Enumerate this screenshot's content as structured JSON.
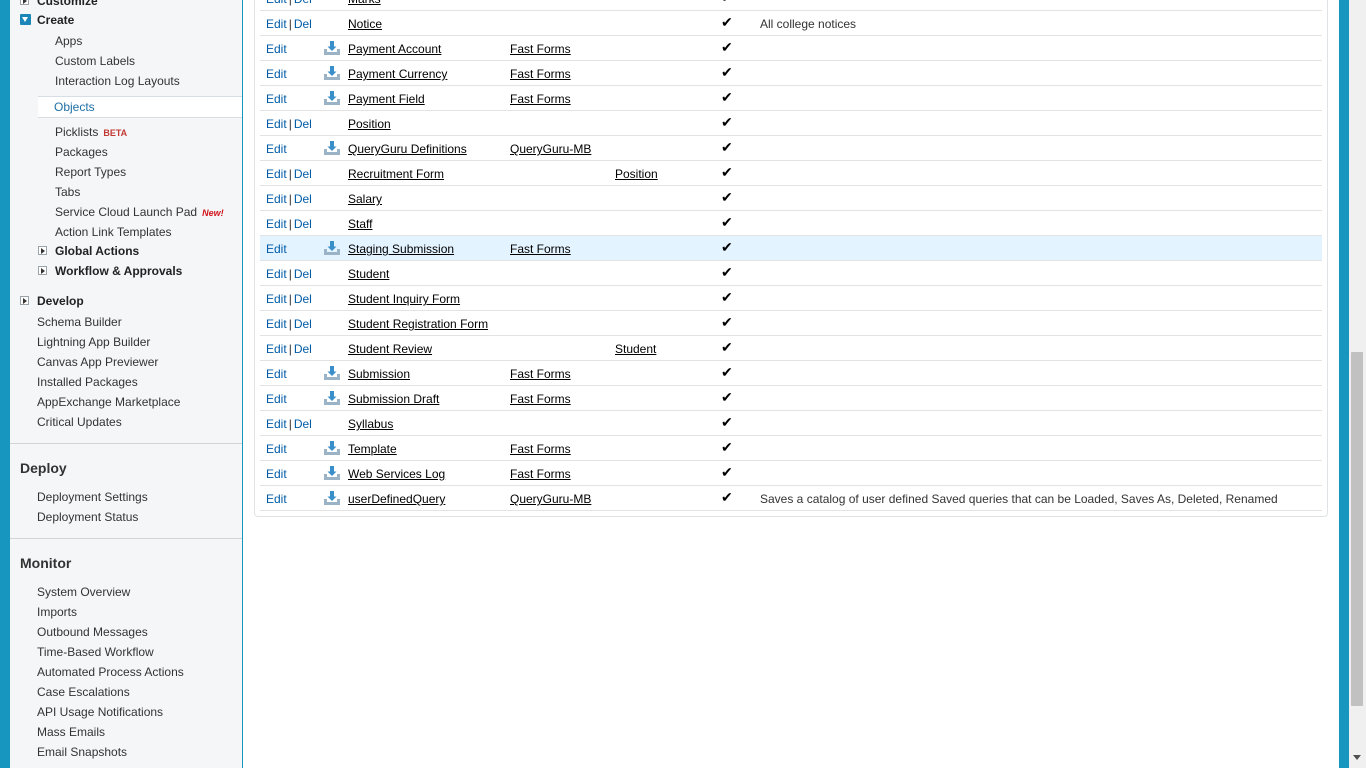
{
  "sidebar": {
    "customize_label": "Customize",
    "create_label": "Create",
    "create_items": [
      {
        "label": "Apps"
      },
      {
        "label": "Custom Labels"
      },
      {
        "label": "Interaction Log Layouts"
      },
      {
        "label": "Objects",
        "selected": true
      },
      {
        "label": "Picklists",
        "badge": "BETA"
      },
      {
        "label": "Packages"
      },
      {
        "label": "Report Types"
      },
      {
        "label": "Tabs"
      },
      {
        "label": "Service Cloud Launch Pad",
        "badge": "New!"
      },
      {
        "label": "Action Link Templates"
      }
    ],
    "global_actions_label": "Global Actions",
    "workflow_label": "Workflow & Approvals",
    "develop_label": "Develop",
    "develop_items": [
      {
        "label": "Schema Builder"
      },
      {
        "label": "Lightning App Builder"
      },
      {
        "label": "Canvas App Previewer"
      },
      {
        "label": "Installed Packages"
      },
      {
        "label": "AppExchange Marketplace"
      },
      {
        "label": "Critical Updates"
      }
    ],
    "deploy_title": "Deploy",
    "deploy_items": [
      {
        "label": "Deployment Settings"
      },
      {
        "label": "Deployment Status"
      }
    ],
    "monitor_title": "Monitor",
    "monitor_items": [
      {
        "label": "System Overview"
      },
      {
        "label": "Imports"
      },
      {
        "label": "Outbound Messages"
      },
      {
        "label": "Time-Based Workflow"
      },
      {
        "label": "Automated Process Actions"
      },
      {
        "label": "Case Escalations"
      },
      {
        "label": "API Usage Notifications"
      },
      {
        "label": "Mass Emails"
      },
      {
        "label": "Email Snapshots"
      }
    ]
  },
  "objects_table": {
    "edit_label": "Edit",
    "del_label": "Del",
    "separator": "|",
    "deployed_mark": "✔",
    "rows": [
      {
        "label": "Marks",
        "has_del": true,
        "managed": false,
        "package": "",
        "master": "",
        "description": ""
      },
      {
        "label": "Notice",
        "has_del": true,
        "managed": false,
        "package": "",
        "master": "",
        "description": "All college notices"
      },
      {
        "label": "Payment Account",
        "has_del": false,
        "managed": true,
        "package": "Fast Forms",
        "master": "",
        "description": ""
      },
      {
        "label": "Payment Currency",
        "has_del": false,
        "managed": true,
        "package": "Fast Forms",
        "master": "",
        "description": ""
      },
      {
        "label": "Payment Field",
        "has_del": false,
        "managed": true,
        "package": "Fast Forms",
        "master": "",
        "description": ""
      },
      {
        "label": "Position",
        "has_del": true,
        "managed": false,
        "package": "",
        "master": "",
        "description": ""
      },
      {
        "label": "QueryGuru Definitions",
        "has_del": false,
        "managed": true,
        "package": "QueryGuru-MB",
        "master": "",
        "description": ""
      },
      {
        "label": "Recruitment Form",
        "has_del": true,
        "managed": false,
        "package": "",
        "master": "Position",
        "description": ""
      },
      {
        "label": "Salary",
        "has_del": true,
        "managed": false,
        "package": "",
        "master": "",
        "description": ""
      },
      {
        "label": "Staff",
        "has_del": true,
        "managed": false,
        "package": "",
        "master": "",
        "description": ""
      },
      {
        "label": "Staging Submission",
        "has_del": false,
        "managed": true,
        "package": "Fast Forms",
        "master": "",
        "description": "",
        "highlighted": true
      },
      {
        "label": "Student",
        "has_del": true,
        "managed": false,
        "package": "",
        "master": "",
        "description": ""
      },
      {
        "label": "Student Inquiry Form",
        "has_del": true,
        "managed": false,
        "package": "",
        "master": "",
        "description": ""
      },
      {
        "label": "Student Registration Form",
        "has_del": true,
        "managed": false,
        "package": "",
        "master": "",
        "description": ""
      },
      {
        "label": "Student Review",
        "has_del": true,
        "managed": false,
        "package": "",
        "master": "Student",
        "description": ""
      },
      {
        "label": "Submission",
        "has_del": false,
        "managed": true,
        "package": "Fast Forms",
        "master": "",
        "description": ""
      },
      {
        "label": "Submission Draft",
        "has_del": false,
        "managed": true,
        "package": "Fast Forms",
        "master": "",
        "description": ""
      },
      {
        "label": "Syllabus",
        "has_del": true,
        "managed": false,
        "package": "",
        "master": "",
        "description": ""
      },
      {
        "label": "Template",
        "has_del": false,
        "managed": true,
        "package": "Fast Forms",
        "master": "",
        "description": ""
      },
      {
        "label": "Web Services Log",
        "has_del": false,
        "managed": true,
        "package": "Fast Forms",
        "master": "",
        "description": ""
      },
      {
        "label": "userDefinedQuery",
        "has_del": false,
        "managed": true,
        "package": "QueryGuru-MB",
        "master": "",
        "description": "Saves a catalog of user defined Saved queries that can be Loaded, Saves As, Deleted, Renamed"
      }
    ]
  }
}
